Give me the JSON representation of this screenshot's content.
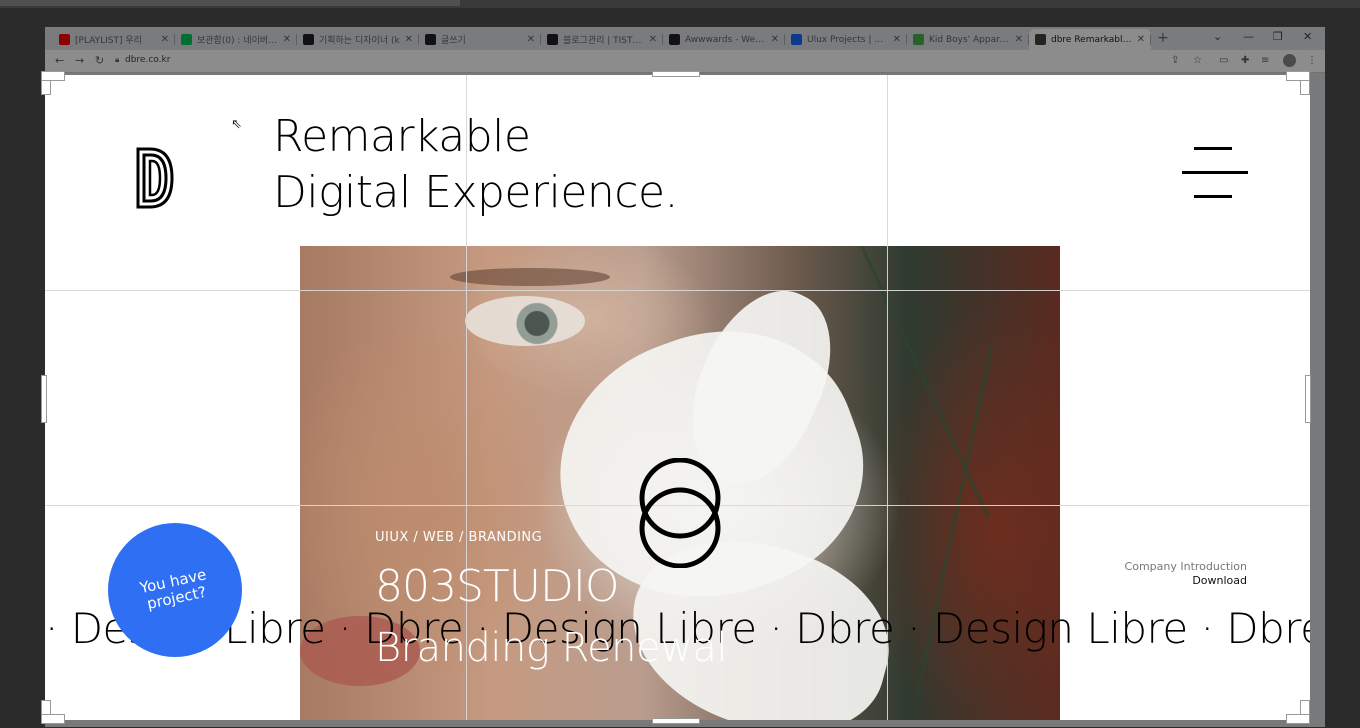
{
  "browser": {
    "tabs": [
      {
        "title": "[PLAYLIST] 우리",
        "favicon_color": "#ff0000"
      },
      {
        "title": "보관함(0) : 네이버 메",
        "favicon_color": "#03c75a"
      },
      {
        "title": "기획하는 디자이너 (k",
        "favicon_color": "#222222"
      },
      {
        "title": "글쓰기",
        "favicon_color": "#222222"
      },
      {
        "title": "블로그관리 | TISTORY",
        "favicon_color": "#222222"
      },
      {
        "title": "Awwwards - Website",
        "favicon_color": "#222222"
      },
      {
        "title": "Ulux Projects | Photo",
        "favicon_color": "#1769ff"
      },
      {
        "title": "Kid Boys' Apparel No",
        "favicon_color": "#4caf50"
      },
      {
        "title": "dbre Remarkable Dig",
        "favicon_color": "#444444"
      }
    ],
    "new_tab": "+",
    "url": "dbre.co.kr"
  },
  "site": {
    "headline_line1": "Remarkable",
    "headline_line2": "Digital Experience.",
    "category": "UIUX / WEB / BRANDING",
    "project_title": "803STUDIO",
    "project_subtitle": "Branding Renewal",
    "marquee": "· Design Libre · Dbre · Design Libre · Dbre · Design Libre · Dbre · Design Libre · Dbre",
    "cta": "You have project?",
    "intro_label": "Company Introduction",
    "intro_download": "Download"
  },
  "colors": {
    "cta_blue": "#2f6ff3",
    "text": "#000000"
  },
  "icons": {
    "logo": "dbre-d-logo",
    "menu": "hamburger-icon",
    "rings": "double-ring-icon"
  }
}
